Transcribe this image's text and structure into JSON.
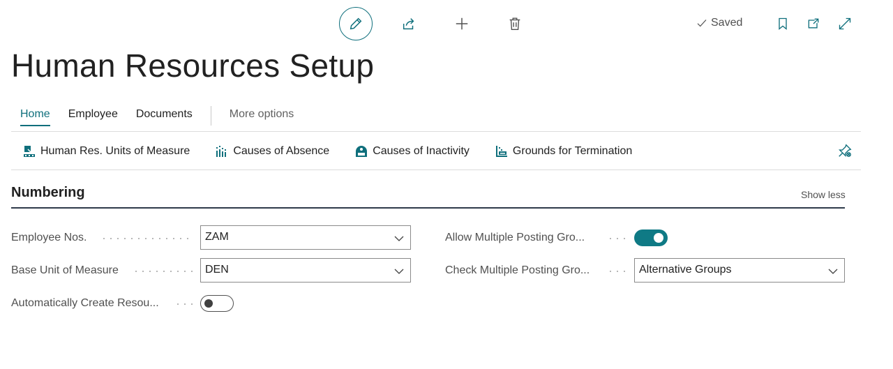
{
  "toolbar": {
    "saved_label": "Saved",
    "icons": [
      "pencil-icon",
      "share-icon",
      "plus-icon",
      "trash-icon",
      "bookmark-icon",
      "open-new-window-icon",
      "expand-icon"
    ]
  },
  "page": {
    "title": "Human Resources Setup"
  },
  "tabs": [
    {
      "label": "Home",
      "active": true
    },
    {
      "label": "Employee"
    },
    {
      "label": "Documents"
    },
    {
      "label": "More options"
    }
  ],
  "actions": [
    {
      "label": "Human Res. Units of Measure",
      "icon": "units-of-measure-icon"
    },
    {
      "label": "Causes of Absence",
      "icon": "causes-of-absence-icon"
    },
    {
      "label": "Causes of Inactivity",
      "icon": "causes-of-inactivity-icon"
    },
    {
      "label": "Grounds for Termination",
      "icon": "grounds-for-termination-icon"
    }
  ],
  "section": {
    "title": "Numbering",
    "show_less": "Show less"
  },
  "fields": {
    "employee_nos": {
      "label": "Employee Nos.",
      "value": "ZAM"
    },
    "base_unit": {
      "label": "Base Unit of Measure",
      "value": "DEN"
    },
    "auto_create": {
      "label": "Automatically Create Resou...",
      "value": false
    },
    "allow_multi": {
      "label": "Allow Multiple Posting Gro...",
      "value": true
    },
    "check_multi": {
      "label": "Check Multiple Posting Gro...",
      "value": "Alternative Groups"
    }
  },
  "colors": {
    "accent": "#0f6f7c",
    "toggle_on": "#0f7a85"
  }
}
